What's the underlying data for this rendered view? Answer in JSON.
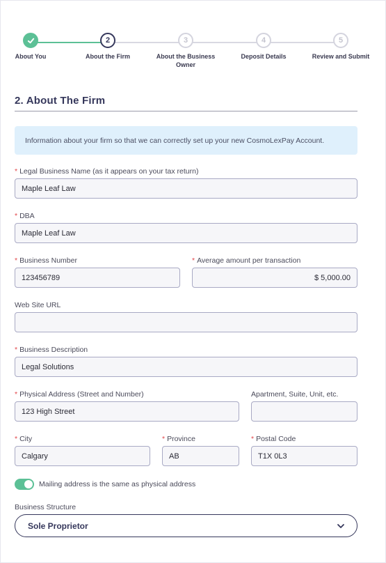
{
  "stepper": {
    "steps": [
      {
        "number": "",
        "label": "About You",
        "state": "complete"
      },
      {
        "number": "2",
        "label": "About the Firm",
        "state": "active"
      },
      {
        "number": "3",
        "label": "About the Business Owner",
        "state": "pending"
      },
      {
        "number": "4",
        "label": "Deposit Details",
        "state": "pending"
      },
      {
        "number": "5",
        "label": "Review and Submit",
        "state": "pending"
      }
    ]
  },
  "section": {
    "title": "2. About The Firm"
  },
  "info": {
    "text": "Information about your firm so that we can correctly set up your new CosmoLexPay Account."
  },
  "fields": {
    "legal_name": {
      "label": "Legal Business Name (as it appears on your tax return)",
      "value": "Maple Leaf Law",
      "required": true
    },
    "dba": {
      "label": "DBA",
      "value": "Maple Leaf Law",
      "required": true
    },
    "business_number": {
      "label": "Business Number",
      "value": "123456789",
      "required": true
    },
    "avg_amount": {
      "label": "Average amount per transaction",
      "value": "$ 5,000.00",
      "required": true
    },
    "website": {
      "label": "Web Site URL",
      "value": "",
      "required": false
    },
    "description": {
      "label": "Business Description",
      "value": "Legal Solutions",
      "required": true
    },
    "address": {
      "label": "Physical Address (Street and Number)",
      "value": "123 High Street",
      "required": true
    },
    "apartment": {
      "label": "Apartment, Suite, Unit, etc.",
      "value": "",
      "required": false
    },
    "city": {
      "label": "City",
      "value": "Calgary",
      "required": true
    },
    "province": {
      "label": "Province",
      "value": "AB",
      "required": true
    },
    "postal": {
      "label": "Postal Code",
      "value": "T1X 0L3",
      "required": true
    }
  },
  "mailing_toggle": {
    "label": "Mailing address is the same as physical address",
    "on": true
  },
  "structure": {
    "label": "Business Structure",
    "value": "Sole Proprietor"
  },
  "colors": {
    "accent_green": "#5cc096",
    "navy": "#35375b",
    "required": "#e2474b",
    "info_bg": "#dff0fc"
  }
}
